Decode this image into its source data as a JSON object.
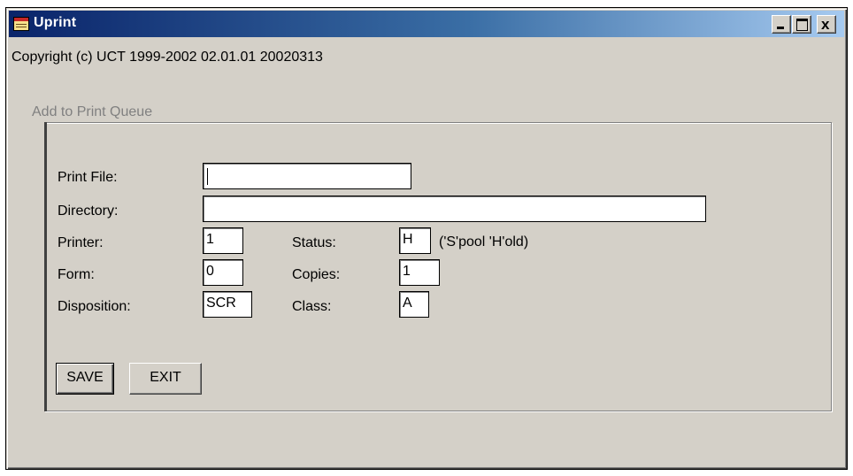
{
  "window": {
    "title": "Uprint",
    "icon": "uprint-app-icon",
    "controls": {
      "minimize": "minimize-icon",
      "maximize": "maximize-icon",
      "close": "x"
    }
  },
  "copyright": "Copyright (c) UCT 1999-2002 02.01.01 20020313",
  "group": {
    "label": "Add to Print Queue"
  },
  "form": {
    "print_file": {
      "label": "Print File:",
      "value": ""
    },
    "directory": {
      "label": "Directory:",
      "value": ""
    },
    "printer": {
      "label": "Printer:",
      "value": "1"
    },
    "status": {
      "label": "Status:",
      "value": "H",
      "hint": "('S'pool 'H'old)"
    },
    "form": {
      "label": "Form:",
      "value": "0"
    },
    "copies": {
      "label": "Copies:",
      "value": "1"
    },
    "disposition": {
      "label": "Disposition:",
      "value": "SCR"
    },
    "class": {
      "label": "Class:",
      "value": "A"
    }
  },
  "buttons": {
    "save": "SAVE",
    "exit": "EXIT"
  }
}
